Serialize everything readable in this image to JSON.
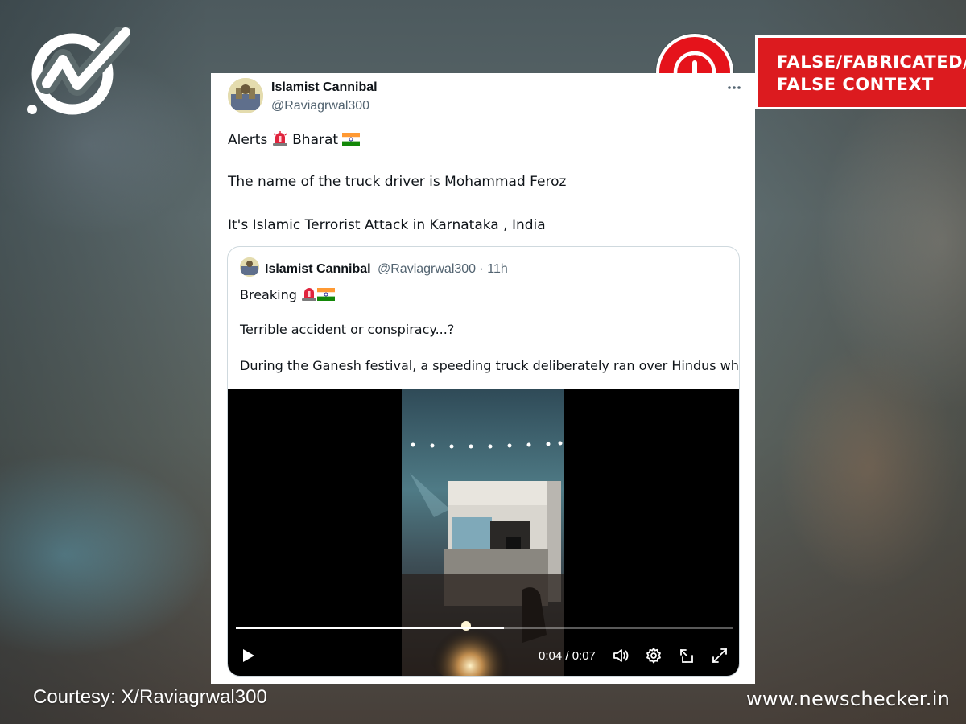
{
  "brand": {
    "logo_icon": "newschecker-check-logo-icon",
    "site_url": "www.newschecker.in",
    "courtesy": "Courtesy: X/Raviagrwal300"
  },
  "verdict": {
    "icon": "exclamation-circle-icon",
    "line1": "FALSE/FABRICATED/",
    "line2": "FALSE CONTEXT",
    "color": "#dc1b1f"
  },
  "tweet": {
    "display_name": "Islamist Cannibal",
    "handle": "@Raviagrwal300",
    "more_icon": "more-options-icon",
    "line1_a": "Alerts",
    "line1_b": "Bharat",
    "line2": "The name of the truck driver is Mohammad Feroz",
    "line3": "It's Islamic Terrorist Attack in Karnataka , India"
  },
  "quoted": {
    "display_name": "Islamist Cannibal",
    "meta": "@Raviagrwal300 · 11h",
    "line1": "Breaking",
    "line2": "Terrible accident or conspiracy...?",
    "line3": "During the Ganesh festival, a speeding truck deliberately ran over Hindus who ..."
  },
  "video": {
    "time": "0:04 / 0:07",
    "progress_fraction": 0.54,
    "controls": [
      "play-icon",
      "volume-icon",
      "settings-gear-icon",
      "pop-out-icon",
      "fullscreen-icon"
    ]
  }
}
